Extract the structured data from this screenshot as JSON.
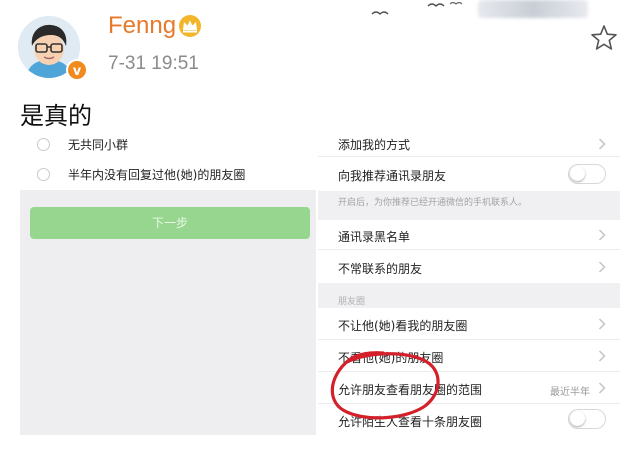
{
  "post": {
    "username": "Fenng",
    "timestamp": "7-31 19:51",
    "text": "是真的",
    "vip_badge": "v",
    "icons": [
      "crown-icon",
      "star-icon"
    ]
  },
  "left_pane": {
    "options": [
      {
        "label": "无共同小群"
      },
      {
        "label": "半年内没有回复过他(她)的朋友圈"
      }
    ],
    "next_button": "下一步"
  },
  "right_pane": {
    "add_me_methods": "添加我的方式",
    "recommend_contacts": "向我推荐通讯录朋友",
    "recommend_hint": "开启后，为你推荐已经开通微信的手机联系人。",
    "contacts_blacklist": "通讯录黑名单",
    "infrequent_friends": "不常联系的朋友",
    "moments_section": "朋友圈",
    "hide_my_moments": "不让他(她)看我的朋友圈",
    "hide_their_moments": "不看他(她)的朋友圈",
    "moments_range_label": "允许朋友查看朋友圈的范围",
    "moments_range_value": "最近半年",
    "strangers_view": "允许陌生人查看十条朋友圈"
  },
  "colors": {
    "username": "#e8792a",
    "accent_green": "#96d68e",
    "highlight_circle": "#d3202a",
    "badge": "#f08a1c"
  }
}
